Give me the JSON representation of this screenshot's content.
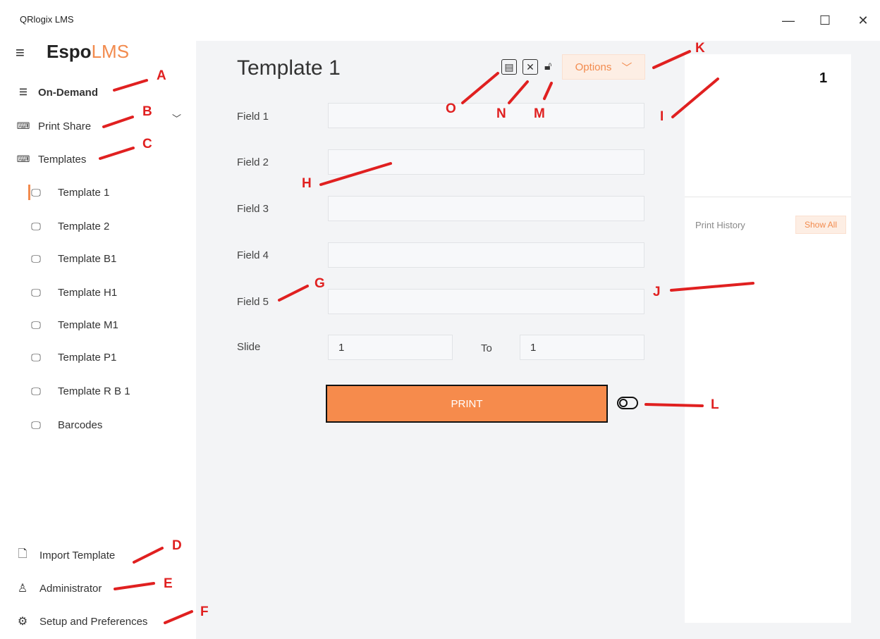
{
  "window": {
    "title": "QRlogix LMS",
    "minimize": "—",
    "maximize": "☐",
    "close": "✕"
  },
  "logo": {
    "espo": "Espo",
    "lms": "LMS"
  },
  "sidebar": {
    "on_demand": "On-Demand",
    "print_share": "Print Share",
    "templates": "Templates",
    "template_items": [
      "Template 1",
      "Template 2",
      "Template B1",
      "Template H1",
      "Template M1",
      "Template P1",
      "Template R B 1",
      "Barcodes"
    ],
    "import_template": "Import Template",
    "administrator": "Administrator",
    "setup": "Setup and Preferences"
  },
  "main": {
    "title": "Template 1",
    "options": "Options",
    "fields": [
      "Field 1",
      "Field 2",
      "Field 3",
      "Field 4",
      "Field 5"
    ],
    "field_values": [
      "",
      "",
      "",
      "",
      ""
    ],
    "slide_label": "Slide",
    "slide_value": "1",
    "to_label": "To",
    "to_value": "1",
    "print": "PRINT"
  },
  "right_panel": {
    "counter": "1",
    "print_history": "Print History",
    "show_all": "Show All"
  },
  "annotations": [
    "A",
    "B",
    "C",
    "D",
    "E",
    "F",
    "G",
    "H",
    "I",
    "J",
    "K",
    "L",
    "M",
    "N",
    "O"
  ],
  "colors": {
    "accent": "#f28b4e",
    "annotation": "#e02020",
    "main_bg": "#f3f4f6"
  },
  "icons": [
    "hamburger-icon",
    "list-icon",
    "keyboard-icon",
    "monitor-icon",
    "save-icon",
    "close-box-icon",
    "lock-icon",
    "chevron-down-icon",
    "document-import-icon",
    "user-icon",
    "gear-icon",
    "toggle-icon"
  ]
}
